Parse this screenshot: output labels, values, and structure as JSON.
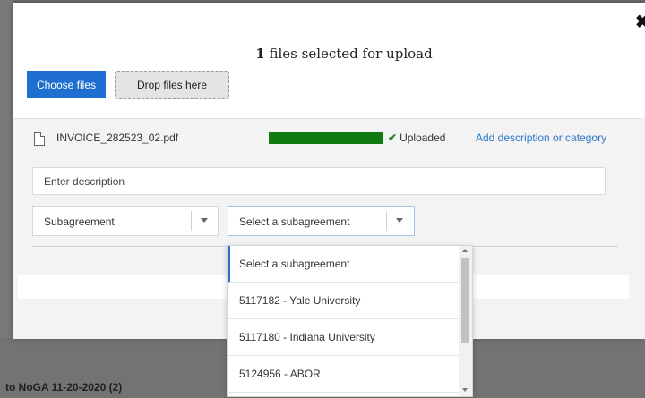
{
  "background": {
    "bottom_text": "to NoGA 11-20-2020 (2)"
  },
  "modal": {
    "close_label": "✖",
    "title_count": "1",
    "title_text": " files selected for upload",
    "choose_files_label": "Choose files",
    "drop_files_label": "Drop files here",
    "file": {
      "name": "INVOICE_282523_02.pdf",
      "progress": 1.0,
      "status": "Uploaded",
      "add_description_link": "Add description or category"
    },
    "description_placeholder": "Enter description",
    "category_select": {
      "selected": "Subagreement"
    },
    "subagreement_select": {
      "selected": "Select a subagreement"
    },
    "dropdown": {
      "options": [
        "Select a subagreement",
        "5117182 - Yale University",
        "5117180 - Indiana University",
        "5124956 - ABOR"
      ]
    }
  },
  "colors": {
    "primary": "#1f6fd1",
    "progress": "#127a12",
    "link": "#2d77c9"
  }
}
